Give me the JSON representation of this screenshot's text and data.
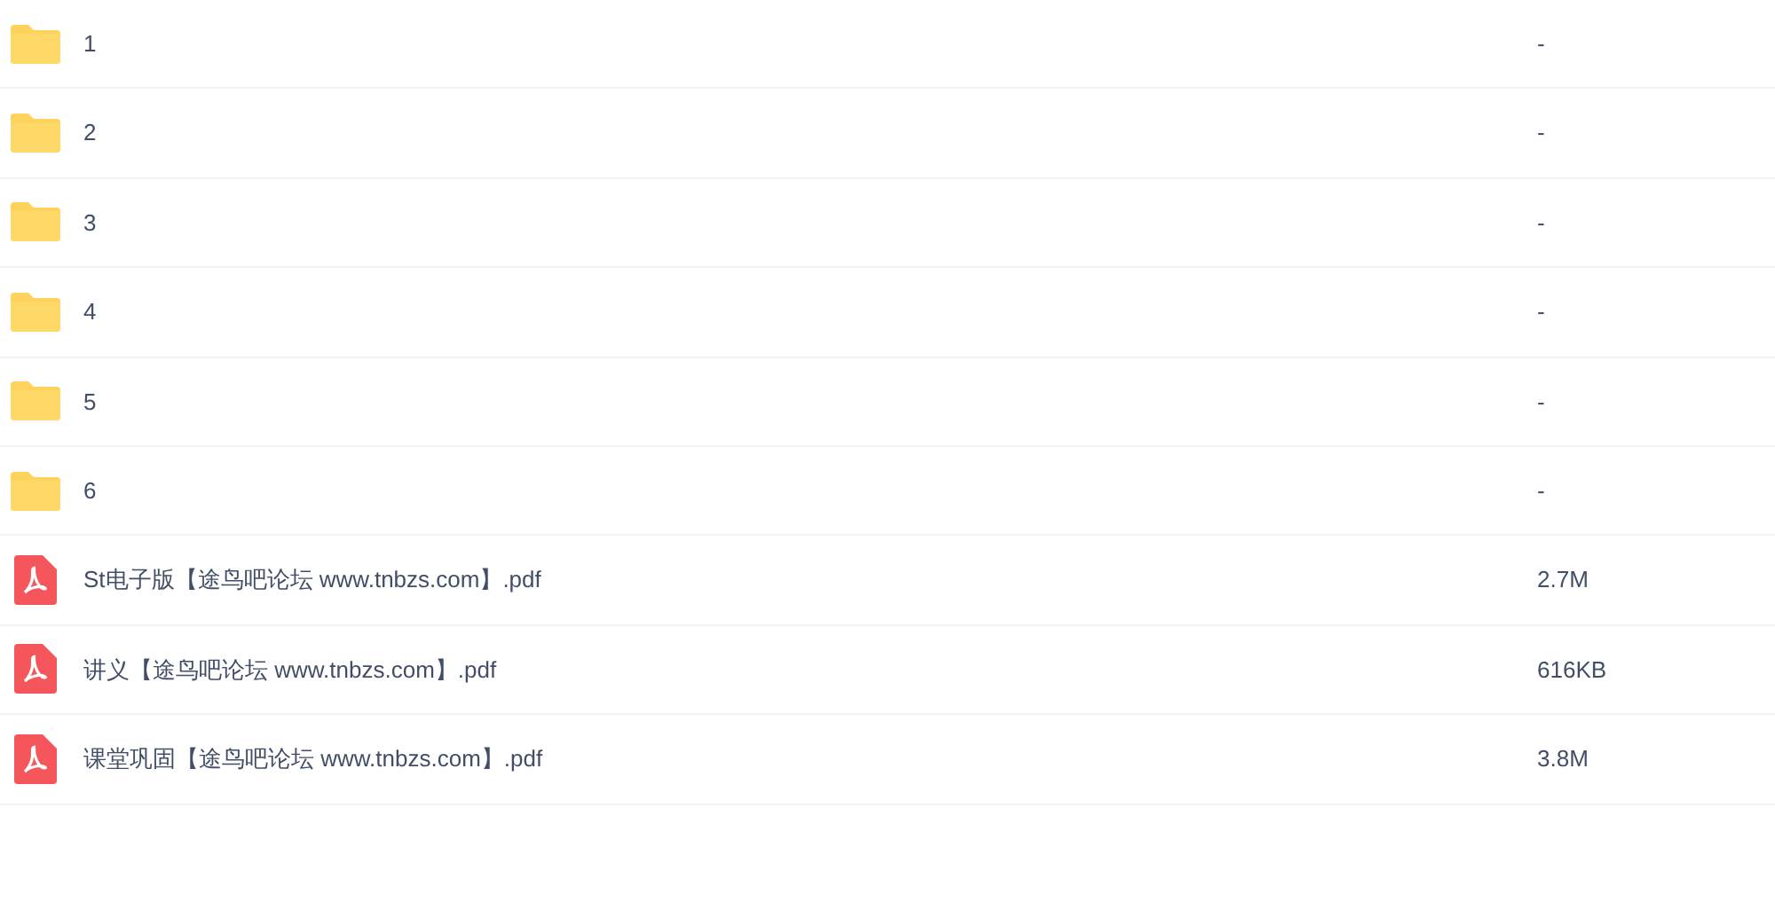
{
  "files": [
    {
      "kind": "folder",
      "name": "1",
      "size": "-"
    },
    {
      "kind": "folder",
      "name": "2",
      "size": "-"
    },
    {
      "kind": "folder",
      "name": "3",
      "size": "-"
    },
    {
      "kind": "folder",
      "name": "4",
      "size": "-"
    },
    {
      "kind": "folder",
      "name": "5",
      "size": "-"
    },
    {
      "kind": "folder",
      "name": "6",
      "size": "-"
    },
    {
      "kind": "pdf",
      "name": "St电子版【途鸟吧论坛 www.tnbzs.com】.pdf",
      "size": "2.7M"
    },
    {
      "kind": "pdf",
      "name": "讲义【途鸟吧论坛 www.tnbzs.com】.pdf",
      "size": "616KB"
    },
    {
      "kind": "pdf",
      "name": "课堂巩固【途鸟吧论坛 www.tnbzs.com】.pdf",
      "size": "3.8M"
    }
  ]
}
